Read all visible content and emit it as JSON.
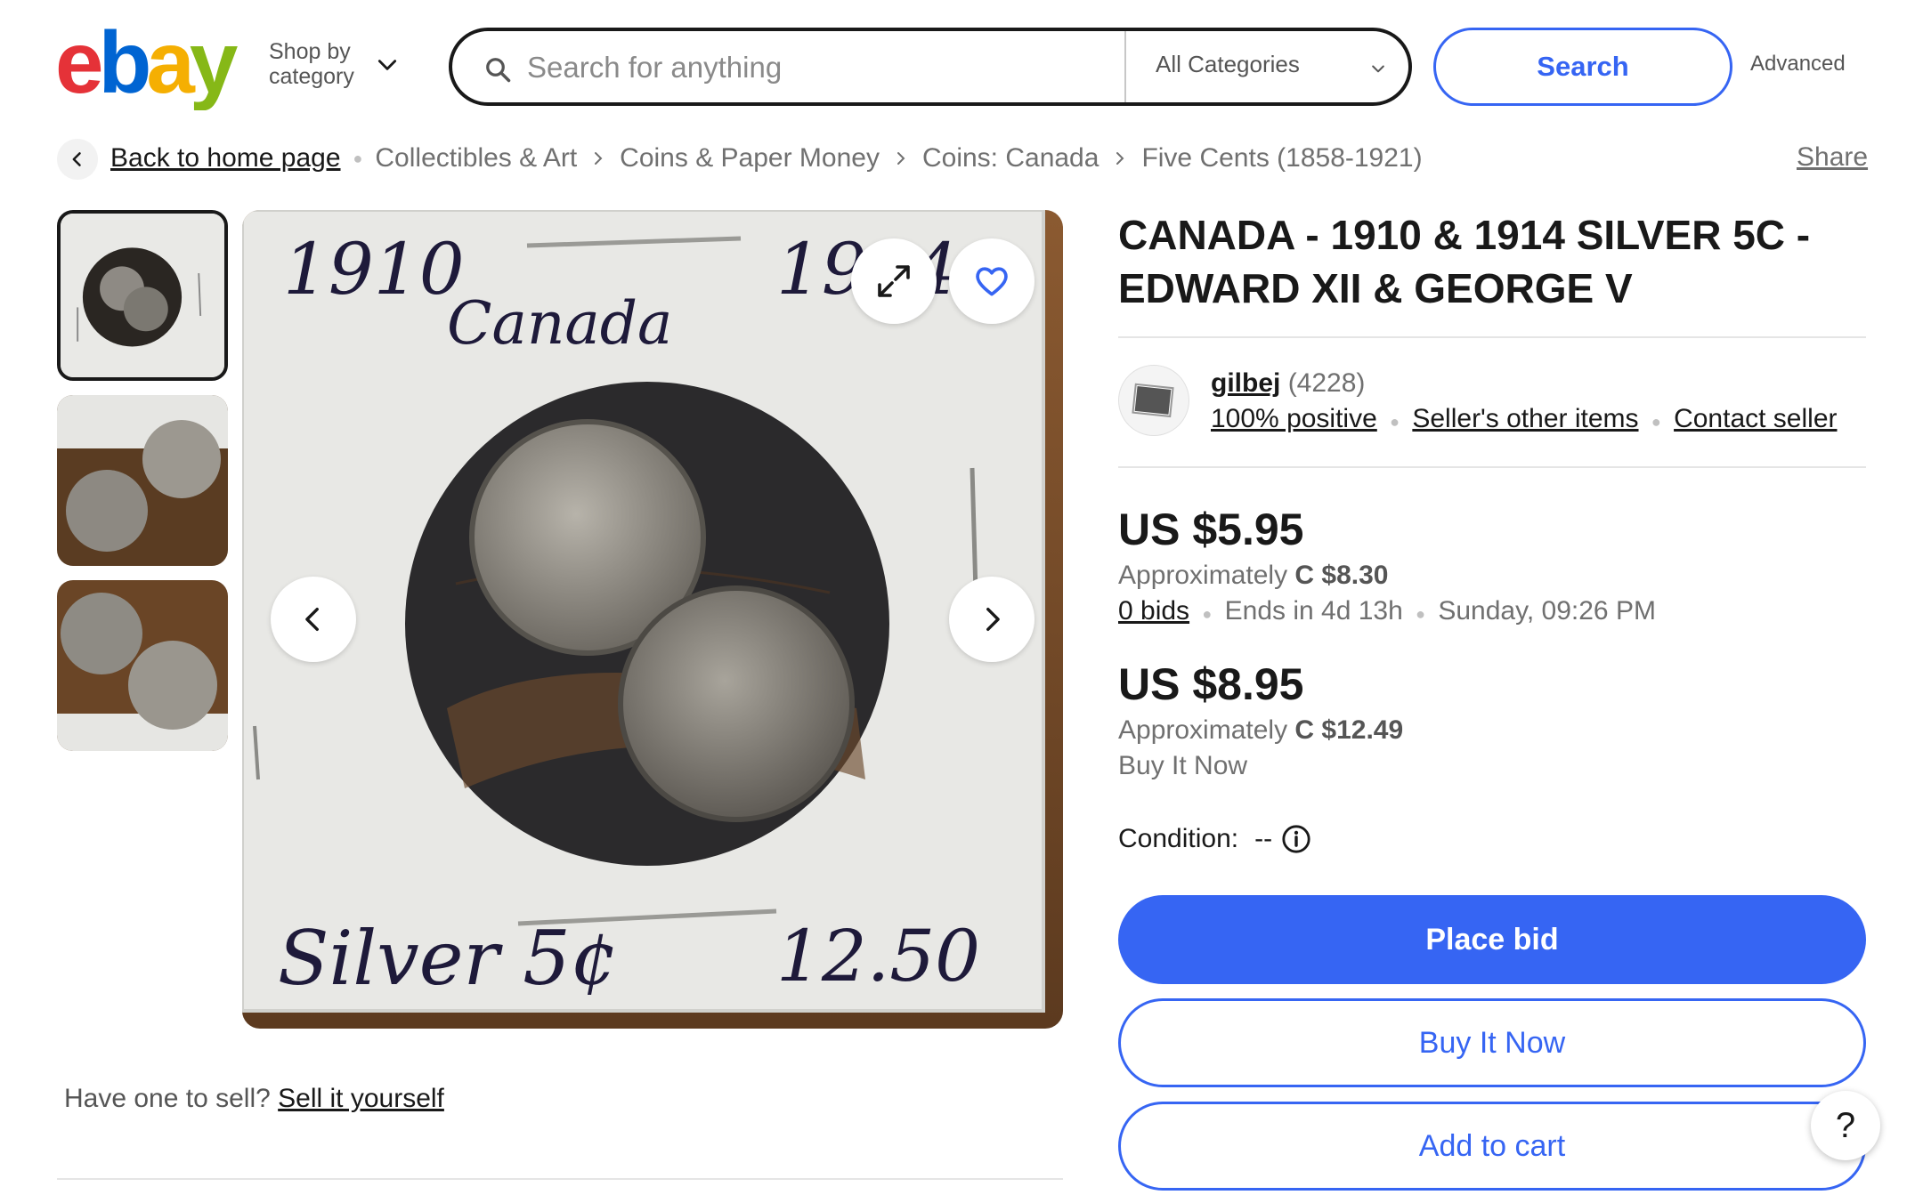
{
  "header": {
    "logo_text": "ebay",
    "shop_by_line1": "Shop by",
    "shop_by_line2": "category",
    "search_placeholder": "Search for anything",
    "category_selected": "All Categories",
    "search_button": "Search",
    "advanced_link": "Advanced",
    "logo_colors": [
      "#e53238",
      "#0064d2",
      "#f5af02",
      "#86b817"
    ]
  },
  "breadcrumb": {
    "back_label": "Back to home page",
    "items": [
      "Collectibles & Art",
      "Coins & Paper Money",
      "Coins: Canada",
      "Five Cents (1858-1921)"
    ],
    "share_label": "Share"
  },
  "gallery": {
    "thumbnail_count": 3,
    "selected_index": 0,
    "image_handwriting": {
      "year_left": "1910",
      "year_right": "1914",
      "country": "Canada",
      "bottom_left": "Silver 5¢",
      "price_note": "12.50"
    },
    "icons": [
      "expand-icon",
      "heart-icon",
      "chevron-left-icon",
      "chevron-right-icon"
    ]
  },
  "sell": {
    "prompt": "Have one to sell?",
    "link": "Sell it yourself"
  },
  "listing": {
    "title": "CANADA - 1910 & 1914 SILVER 5C - EDWARD XII & GEORGE V",
    "seller": {
      "name": "gilbej",
      "feedback_count": "(4228)",
      "positive": "100% positive",
      "other_items": "Seller's other items",
      "contact": "Contact seller"
    },
    "bid_price": "US $5.95",
    "bid_approx_prefix": "Approximately",
    "bid_approx_value": "C $8.30",
    "bids": "0 bids",
    "ends_in": "Ends in 4d 13h",
    "end_time": "Sunday, 09:26 PM",
    "bin_price": "US $8.95",
    "bin_approx_prefix": "Approximately",
    "bin_approx_value": "C $12.49",
    "bin_label": "Buy It Now",
    "condition_label": "Condition:",
    "condition_value": "--"
  },
  "actions": {
    "place_bid": "Place bid",
    "buy_it_now": "Buy It Now",
    "add_to_cart": "Add to cart",
    "help": "?",
    "accent_color": "#3665f3"
  }
}
